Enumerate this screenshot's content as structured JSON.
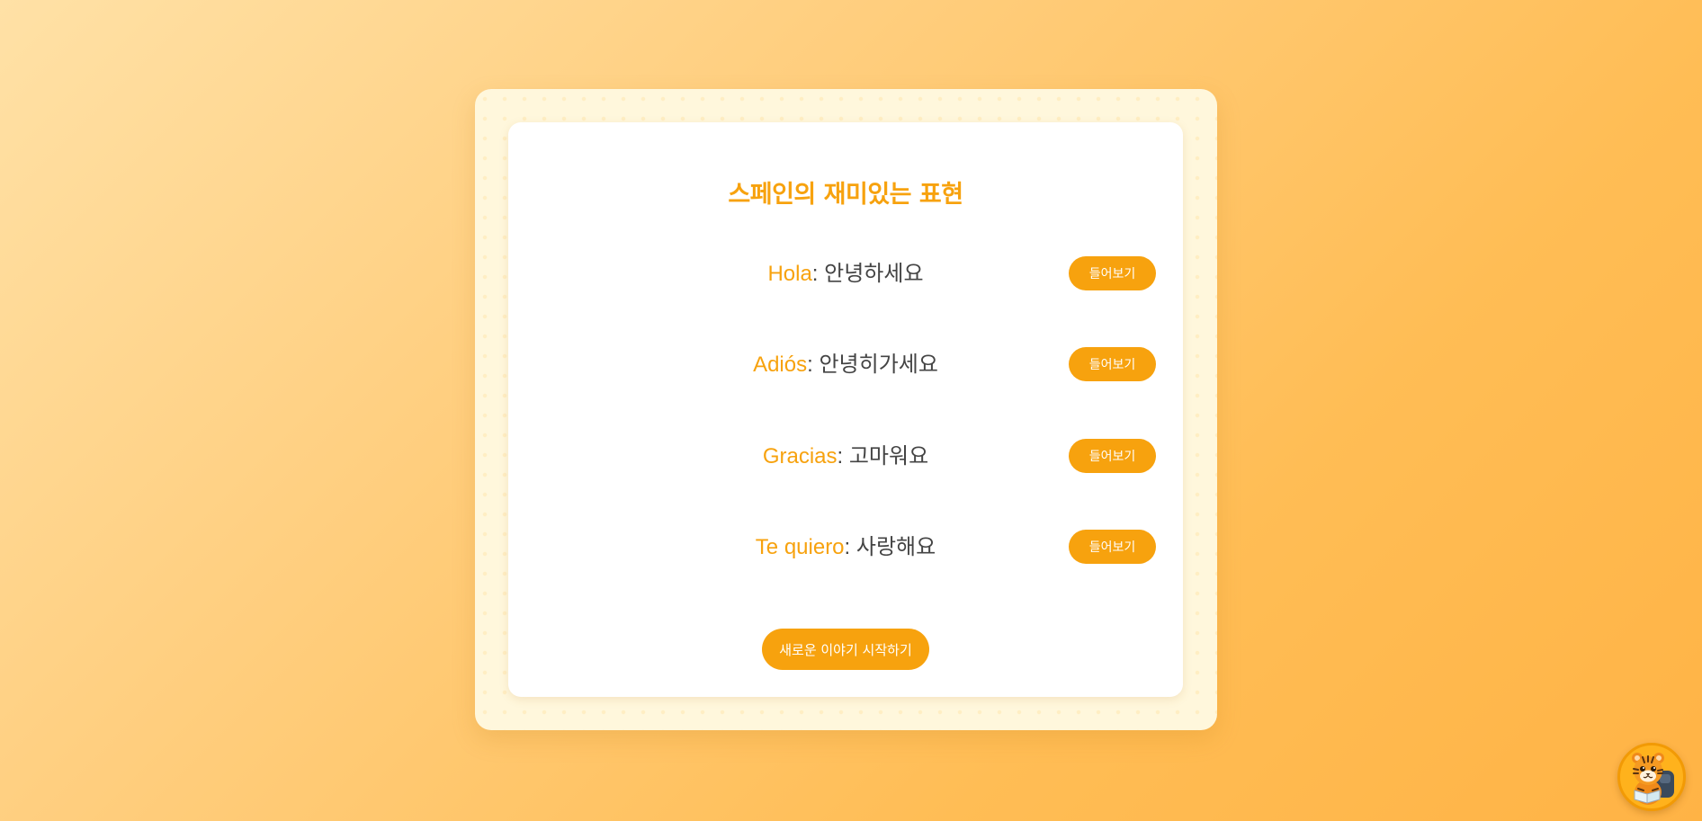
{
  "card": {
    "title": "스페인의 재미있는 표현",
    "phrases": [
      {
        "spanish": "Hola",
        "separator": ": ",
        "korean": "안녕하세요",
        "button_label": "들어보기"
      },
      {
        "spanish": "Adiós",
        "separator": ": ",
        "korean": "안녕히가세요",
        "button_label": "들어보기"
      },
      {
        "spanish": "Gracias",
        "separator": ": ",
        "korean": "고마워요",
        "button_label": "들어보기"
      },
      {
        "spanish": "Te quiero",
        "separator": ": ",
        "korean": "사랑해요",
        "button_label": "들어보기"
      }
    ],
    "new_story_label": "새로운 이야기 시작하기"
  },
  "avatar": {
    "icon": "tiger-mascot-icon"
  },
  "colors": {
    "accent": "#f7a20e",
    "text": "#444444",
    "background_start": "#ffe1a6",
    "background_end": "#ffb345"
  }
}
